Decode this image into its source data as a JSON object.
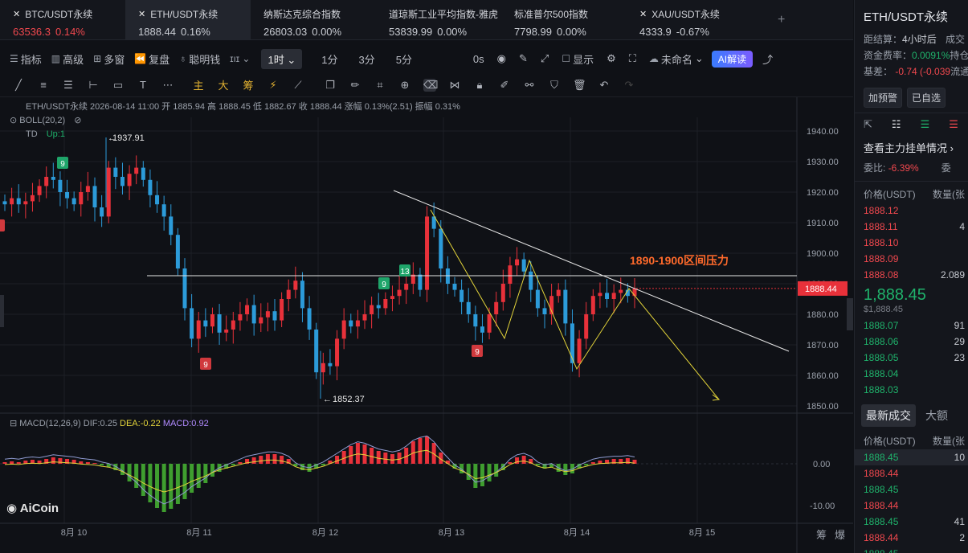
{
  "tickers": [
    {
      "name": "BTC/USDT永续",
      "price": "63536.3",
      "change": "0.14%",
      "color": "red",
      "active": false
    },
    {
      "name": "ETH/USDT永续",
      "price": "1888.44",
      "change": "0.16%",
      "color": "neu",
      "active": true
    },
    {
      "name": "纳斯达克综合指数",
      "price": "26803.03",
      "change": "0.00%",
      "color": "neu",
      "active": false
    },
    {
      "name": "道琼斯工业平均指数-雅虎",
      "price": "53839.99",
      "change": "0.00%",
      "color": "neu",
      "active": false
    },
    {
      "name": "标准普尔500指数",
      "price": "7798.99",
      "change": "0.00%",
      "color": "neu",
      "active": false
    },
    {
      "name": "XAU/USDT永续",
      "price": "4333.9",
      "change": "-0.67%",
      "color": "neu",
      "active": false
    }
  ],
  "toolbar": {
    "indicators": "指标",
    "advanced": "高级",
    "multi": "多窗",
    "replay": "复盘",
    "smart": "聪明钱",
    "timeframe": "1时",
    "tf1": "1分",
    "tf3": "3分",
    "tf5": "5分",
    "zero": "0s",
    "display": "显示",
    "unnamed": "未命名",
    "ai": "AI解读"
  },
  "drawbar": {
    "t1": "主",
    "t2": "大",
    "t3": "筹"
  },
  "legend": {
    "line1": "ETH/USDT永续 2026-08-14 11:00 开 1885.94 高 1888.45 低 1882.67 收 1888.44 涨幅 0.13%(2.51) 振幅 0.31%",
    "boll": "BOLL(20,2)",
    "td": "TD",
    "td_up": "Up:1",
    "macd": "MACD(12,26,9)",
    "dif": "DIF:0.25",
    "dea": "DEA:-0.22",
    "macdv": "MACD:0.92"
  },
  "chart_data": {
    "type": "candlestick",
    "price_axis": [
      "1940.00",
      "1930.00",
      "1920.00",
      "1910.00",
      "1900.00",
      "1890.00",
      "1880.00",
      "1870.00",
      "1860.00",
      "1850.00"
    ],
    "ylim": [
      1848,
      1944
    ],
    "current_price": "1888.44",
    "high_label": "1937.91",
    "low_label": "1852.37",
    "annotation": "1890-1900区间压力",
    "td_labels": [
      "9",
      "9",
      "13",
      "9",
      "9"
    ],
    "date_labels": [
      "8月 10",
      "8月 11",
      "8月 12",
      "8月 13",
      "8月 14",
      "8月 15"
    ],
    "macd_axis": [
      "0.00",
      "-10.00"
    ],
    "close_series": [
      1916,
      1918,
      1916,
      1917,
      1919,
      1922,
      1925,
      1924,
      1920,
      1918,
      1916,
      1920,
      1922,
      1915,
      1912,
      1928,
      1925,
      1922,
      1926,
      1928,
      1924,
      1919,
      1916,
      1912,
      1906,
      1895,
      1882,
      1872,
      1878,
      1876,
      1880,
      1874,
      1875,
      1878,
      1880,
      1883,
      1877,
      1879,
      1881,
      1878,
      1885,
      1888,
      1891,
      1882,
      1875,
      1861,
      1864,
      1863,
      1872,
      1878,
      1876,
      1878,
      1880,
      1883,
      1882,
      1885,
      1886,
      1888,
      1890,
      1893,
      1888,
      1912,
      1908,
      1895,
      1890,
      1888,
      1884,
      1880,
      1876,
      1874,
      1880,
      1884,
      1890,
      1896,
      1898,
      1894,
      1888,
      1882,
      1880,
      1886,
      1888,
      1877,
      1864,
      1872,
      1880,
      1886,
      1887,
      1885,
      1887,
      1888,
      1886,
      1888.44
    ]
  },
  "right_panel": {
    "title": "ETH/USDT永续",
    "settle": "距结算：",
    "settle_v": "4小时后",
    "deal": "成交",
    "funding": "资金费率：",
    "funding_v": "0.0091%",
    "hold": "持仓",
    "basis": "基差：",
    "basis_v": "-0.74 (-0.039",
    "flow": "流通",
    "btn_alert": "加预警",
    "btn_fav": "已自选",
    "main_orders": "查看主力挂单情况",
    "ratio": "委比:",
    "ratio_v": "-6.39%",
    "wei": "委",
    "price_hdr": "价格(USDT)",
    "qty_hdr": "数量(张",
    "asks": [
      [
        "1888.12",
        ""
      ],
      [
        "1888.11",
        "4"
      ],
      [
        "1888.10",
        ""
      ],
      [
        "1888.09",
        ""
      ],
      [
        "1888.08",
        "2.089"
      ]
    ],
    "last": "1,888.45",
    "last_usd": "$1,888.45",
    "bids": [
      [
        "1888.07",
        "91"
      ],
      [
        "1888.06",
        "29"
      ],
      [
        "1888.05",
        "23"
      ],
      [
        "1888.04",
        ""
      ],
      [
        "1888.03",
        ""
      ]
    ],
    "tab_latest": "最新成交",
    "tab_large": "大额",
    "trades": [
      [
        "1888.45",
        "10",
        "g"
      ],
      [
        "1888.44",
        "",
        "r"
      ],
      [
        "1888.45",
        "",
        "g"
      ],
      [
        "1888.44",
        "",
        "r"
      ],
      [
        "1888.45",
        "41",
        "g"
      ],
      [
        "1888.44",
        "2",
        "r"
      ],
      [
        "1888.45",
        "",
        "g"
      ]
    ]
  },
  "bottom": {
    "zoom_a": "筹",
    "zoom_b": "爆"
  }
}
